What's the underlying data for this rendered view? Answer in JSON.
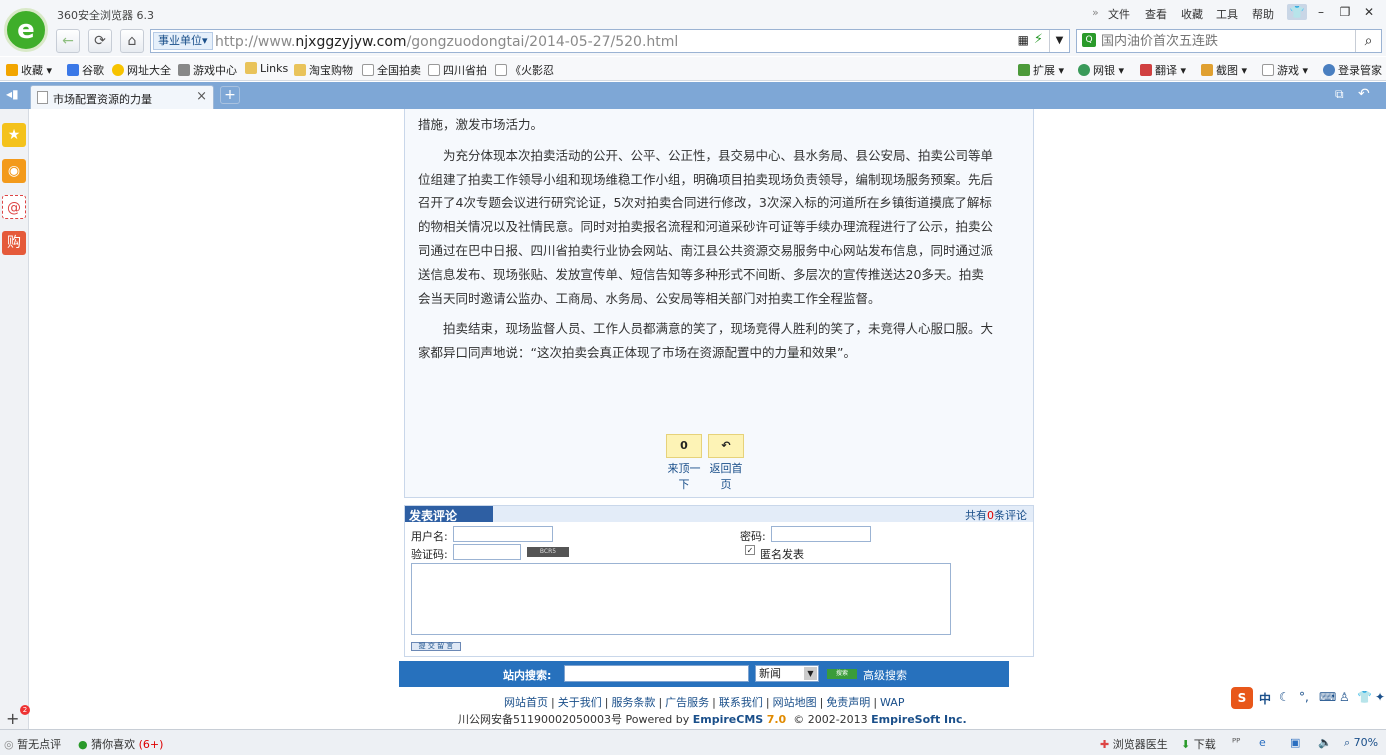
{
  "browser": {
    "app_title": "360安全浏览器 6.3",
    "menu": [
      "文件",
      "查看",
      "收藏",
      "工具",
      "帮助"
    ],
    "chevrons": "»",
    "address_badge": "事业单位",
    "url_prefix": "http://www.",
    "url_domain": "njxggzyjyw.com",
    "url_path": "/gongzuodongtai/2014-05-27/520.html",
    "search_placeholder": "国内油价首次五连跌"
  },
  "bookmarks": [
    {
      "label": "收藏",
      "icon": "star-icon",
      "color": "#f2a500"
    },
    {
      "label": "谷歌",
      "icon": "google-icon",
      "color": "#3b78e7"
    },
    {
      "label": "网址大全",
      "icon": "globe-icon",
      "color": "#f7c300"
    },
    {
      "label": "游戏中心",
      "icon": "gamepad-icon",
      "color": "#666666"
    },
    {
      "label": "Links",
      "icon": "folder-icon",
      "color": "#e9c35a"
    },
    {
      "label": "淘宝购物",
      "icon": "folder-icon",
      "color": "#e9c35a"
    },
    {
      "label": "全国拍卖",
      "icon": "page-icon",
      "color": "#cccccc"
    },
    {
      "label": "四川省拍",
      "icon": "page-icon",
      "color": "#cccccc"
    },
    {
      "label": "《火影忍",
      "icon": "page-icon",
      "color": "#cccccc"
    }
  ],
  "toolbar_right": [
    {
      "label": "扩展",
      "icon": "extension-icon"
    },
    {
      "label": "网银",
      "icon": "bank-icon"
    },
    {
      "label": "翻译",
      "icon": "translate-icon"
    },
    {
      "label": "截图",
      "icon": "screenshot-icon"
    },
    {
      "label": "游戏",
      "icon": "game-icon"
    },
    {
      "label": "登录管家",
      "icon": "login-icon"
    }
  ],
  "tab": {
    "title": "市场配置资源的力量",
    "close": "×",
    "new_tab": "+"
  },
  "article": {
    "p1": "措施，激发市场活力。",
    "p2": "为充分体现本次拍卖活动的公开、公平、公正性，县交易中心、县水务局、县公安局、拍卖公司等单位组建了拍卖工作领导小组和现场维稳工作小组，明确项目拍卖现场负责领导，编制现场服务预案。先后召开了4次专题会议进行研究论证，5次对拍卖合同进行修改，3次深入标的河道所在乡镇街道摸底了解标的物相关情况以及社情民意。同时对拍卖报名流程和河道采砂许可证等手续办理流程进行了公示，拍卖公司通过在巴中日报、四川省拍卖行业协会网站、南江县公共资源交易服务中心网站发布信息，同时通过派送信息发布、现场张贴、发放宣传单、短信告知等多种形式不间断、多层次的宣传推送达20多天。拍卖会当天同时邀请公监办、工商局、水务局、公安局等相关部门对拍卖工作全程监督。",
    "p3": "拍卖结束，现场监督人员、工作人员都满意的笑了，现场竞得人胜利的笑了，未竞得人心服口服。大家都异口同声地说：“这次拍卖会真正体现了市场在资源配置中的力量和效果”。",
    "vote_count": "0",
    "vote_label": "来顶一下",
    "back_icon": "↶",
    "back_label": "返回首页"
  },
  "comment": {
    "title": "发表评论",
    "count_prefix": "共有",
    "count": "0",
    "count_suffix": "条评论",
    "username_label": "用户名:",
    "password_label": "密码:",
    "captcha_label": "验证码:",
    "captcha_text": "BCR5",
    "anonymous_label": "匿名发表",
    "submit_label": "提 交 留 言"
  },
  "site_search": {
    "label": "站内搜索:",
    "select_value": "新闻",
    "go_label": "搜索",
    "advanced": "高级搜索"
  },
  "footer": {
    "links": [
      "网站首页",
      "关于我们",
      "服务条款",
      "广告服务",
      "联系我们",
      "网站地图",
      "免责声明",
      "WAP"
    ],
    "icp": "川公网安备51190002050003号",
    "powered": "Powered by",
    "cms": "EmpireCMS",
    "version": "7.0",
    "copyright": "© 2002-2013",
    "company": "EmpireSoft Inc."
  },
  "statusbar": {
    "review": "暂无点评",
    "guess": "猜你喜欢",
    "guess_count": "(6+)",
    "doctor": "浏览器医生",
    "download": "下载",
    "zoom": "70%",
    "sidebar_badge": "2"
  },
  "ime": {
    "label": "中"
  }
}
